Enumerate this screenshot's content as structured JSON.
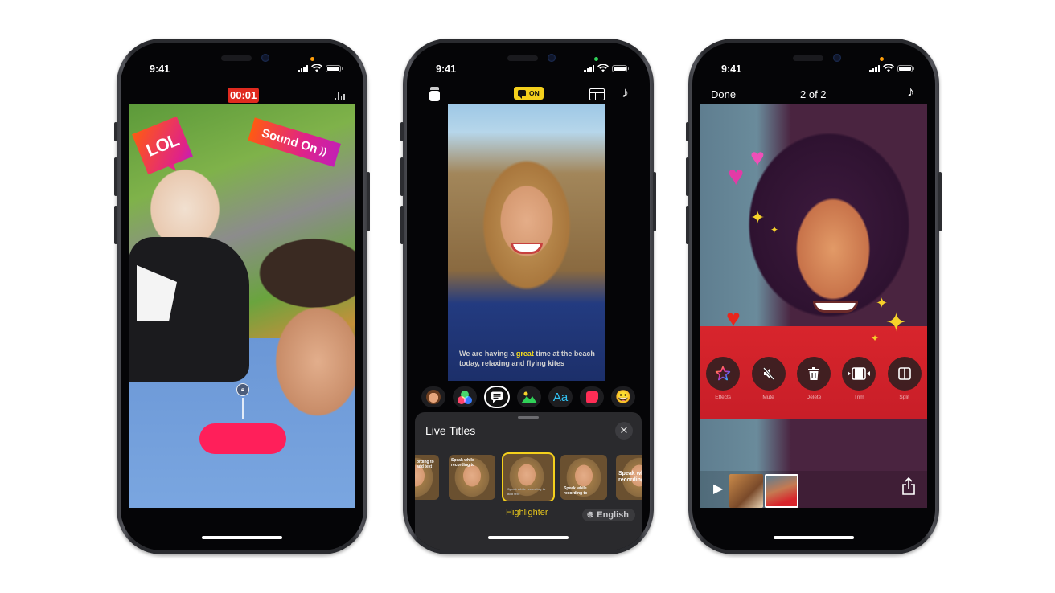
{
  "status_bar": {
    "time": "9:41"
  },
  "phone_recording": {
    "timer": "00:01",
    "stickers": {
      "lol": "LOL",
      "sound_on": "Sound On"
    },
    "icons": {
      "audio_level": "audio-level-icon",
      "lock": "lock-icon",
      "record": "record-button"
    },
    "colors": {
      "timer_bg": "#e02a1f",
      "record": "#ff1f5a",
      "privacy_dot": "#ff9f0a"
    }
  },
  "phone_live_titles": {
    "toolbar_top": {
      "live_titles_toggle": "ON",
      "icons": [
        "cards-icon",
        "caption-bubble-icon",
        "layout-icon",
        "music-note-icon"
      ]
    },
    "caption": {
      "before": "We are having a ",
      "highlight": "great",
      "after": " time at the beach today, relaxing and flying kites"
    },
    "tools": [
      "memoji",
      "filters",
      "live-titles",
      "backgrounds",
      "text",
      "stickers",
      "emoji"
    ],
    "sheet": {
      "title": "Live Titles",
      "styles": [
        {
          "caption": "ording to add text"
        },
        {
          "caption": "Speak while recording to"
        },
        {
          "caption": "Speak while recording to add text",
          "selected": true
        },
        {
          "caption": "Speak while recording to"
        },
        {
          "caption": "Speak while recording to"
        }
      ],
      "selected_style": "Highlighter",
      "language": "English"
    },
    "colors": {
      "accent": "#f4d01c",
      "privacy_dot": "#30d158",
      "sheet_bg": "#2a2a2d"
    }
  },
  "phone_editor": {
    "done": "Done",
    "counter": "2 of 2",
    "actions": [
      {
        "label": "Effects",
        "icon": "star-icon"
      },
      {
        "label": "Mute",
        "icon": "speaker-mute-icon"
      },
      {
        "label": "Delete",
        "icon": "trash-icon"
      },
      {
        "label": "Trim",
        "icon": "trim-icon"
      },
      {
        "label": "Split",
        "icon": "split-icon"
      }
    ],
    "clips": 2,
    "selected_clip": 2
  }
}
